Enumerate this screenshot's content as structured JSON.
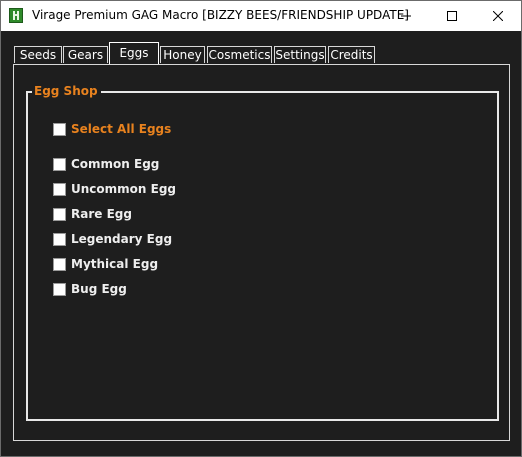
{
  "window": {
    "title": "Virage Premium GAG Macro [BIZZY BEES/FRIENDSHIP UPDATE]",
    "icon": "app-h-icon"
  },
  "tabs": [
    {
      "label": "Seeds",
      "active": false
    },
    {
      "label": "Gears",
      "active": false
    },
    {
      "label": "Eggs",
      "active": true
    },
    {
      "label": "Honey",
      "active": false
    },
    {
      "label": "Cosmetics",
      "active": false
    },
    {
      "label": "Settings",
      "active": false
    },
    {
      "label": "Credits",
      "active": false
    }
  ],
  "egg_shop": {
    "group_label": "Egg Shop",
    "select_all_label": "Select All Eggs",
    "eggs": [
      {
        "label": "Common Egg",
        "checked": false
      },
      {
        "label": "Uncommon Egg",
        "checked": false
      },
      {
        "label": "Rare Egg",
        "checked": false
      },
      {
        "label": "Legendary Egg",
        "checked": false
      },
      {
        "label": "Mythical Egg",
        "checked": false
      },
      {
        "label": "Bug Egg",
        "checked": false
      }
    ]
  },
  "colors": {
    "background": "#1e1e1e",
    "accent": "#e8821e",
    "text": "#eeeeee",
    "titlebar": "#ffffff"
  }
}
